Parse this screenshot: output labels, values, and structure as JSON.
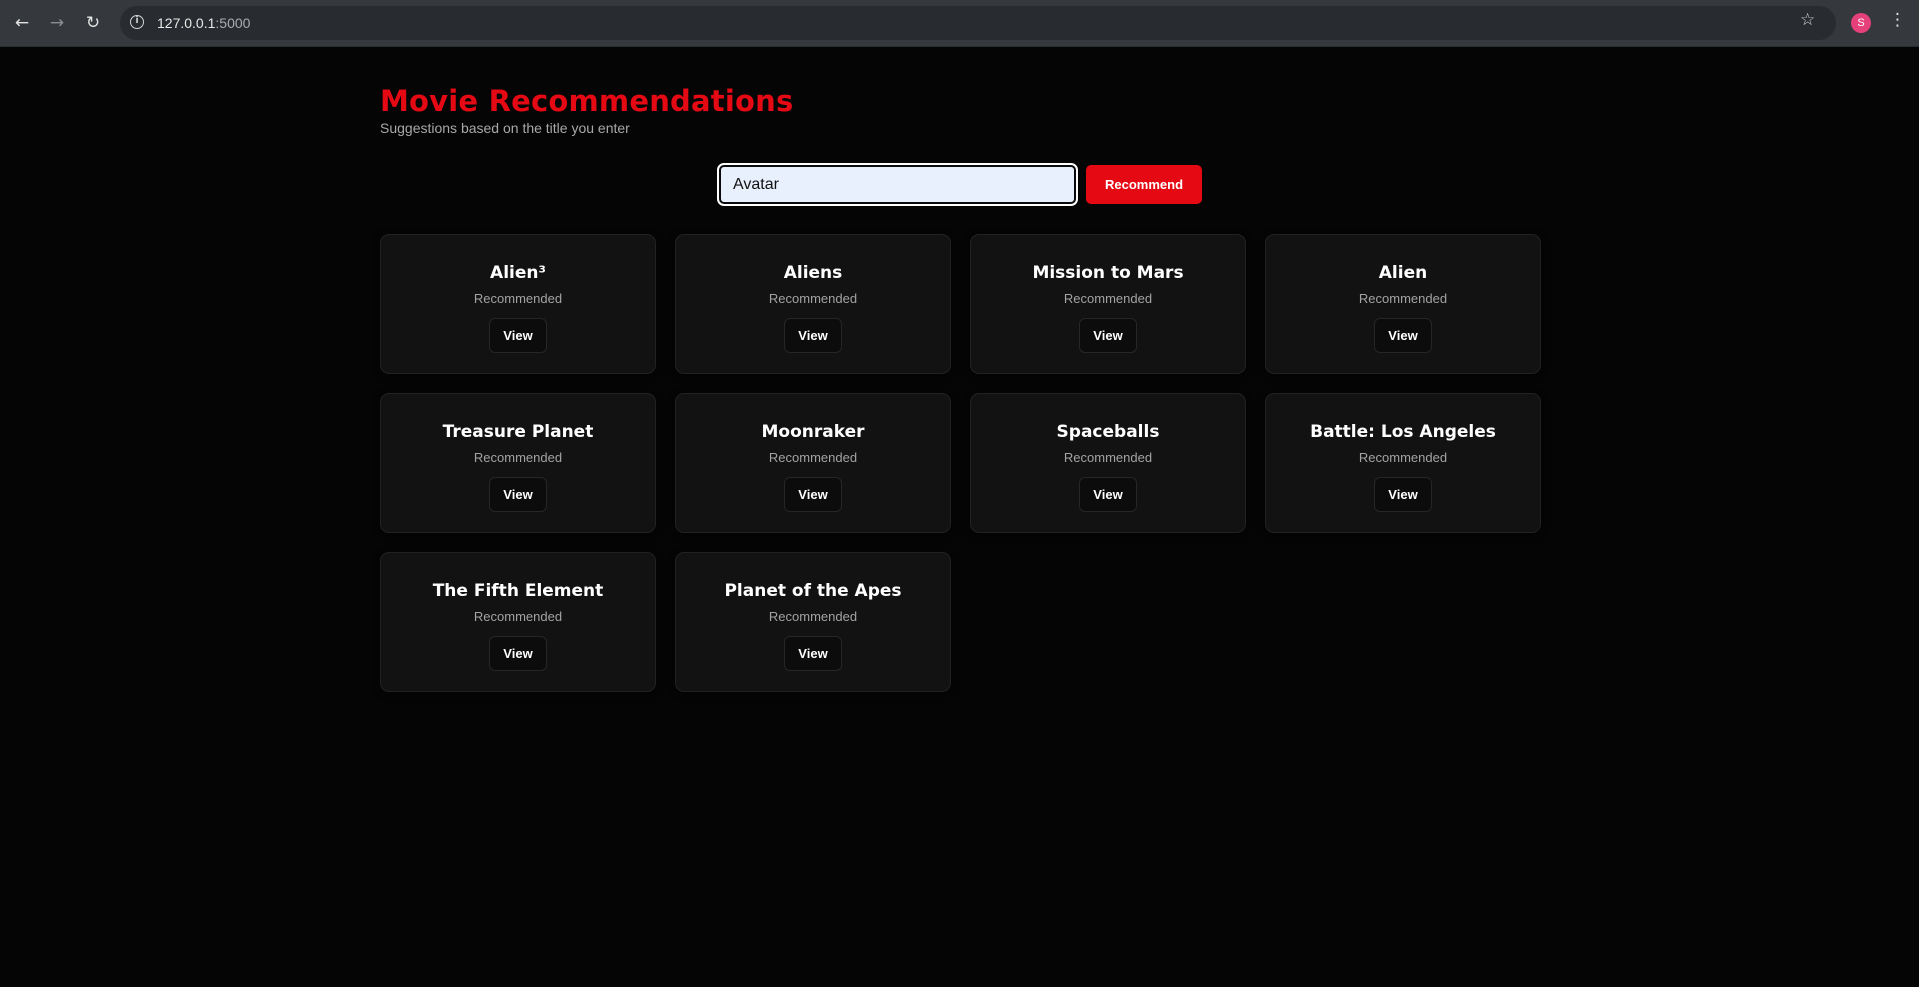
{
  "browser": {
    "url_host": "127.0.0.1",
    "url_port": ":5000",
    "avatar_letter": "S",
    "colors": {
      "chrome": "#35393e",
      "avatar": "#e5407a"
    }
  },
  "header": {
    "title": "Movie Recommendations",
    "subtitle": "Suggestions based on the title you enter"
  },
  "search": {
    "value": "Avatar",
    "button_label": "Recommend"
  },
  "colors": {
    "accent": "#e50914",
    "background": "#050505",
    "card": "#121212"
  },
  "cards": [
    {
      "title": "Alien³",
      "subtitle": "Recommended",
      "button": "View"
    },
    {
      "title": "Aliens",
      "subtitle": "Recommended",
      "button": "View"
    },
    {
      "title": "Mission to Mars",
      "subtitle": "Recommended",
      "button": "View"
    },
    {
      "title": "Alien",
      "subtitle": "Recommended",
      "button": "View"
    },
    {
      "title": "Treasure Planet",
      "subtitle": "Recommended",
      "button": "View"
    },
    {
      "title": "Moonraker",
      "subtitle": "Recommended",
      "button": "View"
    },
    {
      "title": "Spaceballs",
      "subtitle": "Recommended",
      "button": "View"
    },
    {
      "title": "Battle: Los Angeles",
      "subtitle": "Recommended",
      "button": "View"
    },
    {
      "title": "The Fifth Element",
      "subtitle": "Recommended",
      "button": "View"
    },
    {
      "title": "Planet of the Apes",
      "subtitle": "Recommended",
      "button": "View"
    }
  ]
}
